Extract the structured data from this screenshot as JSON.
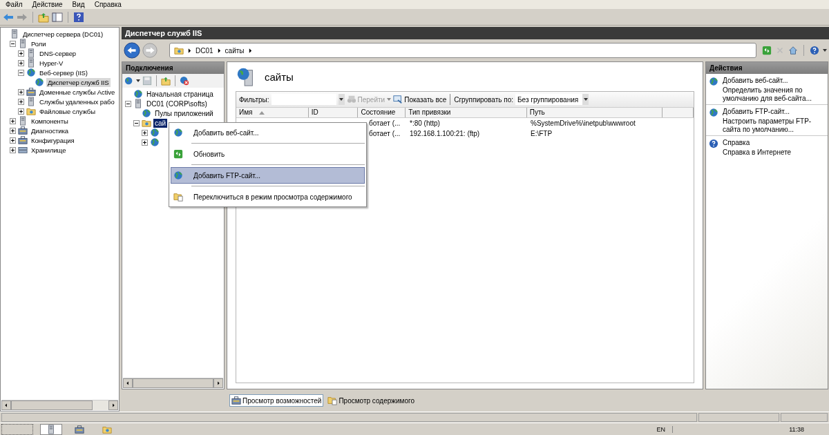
{
  "menu_bar": [
    {
      "label": "Файл"
    },
    {
      "label": "Действие"
    },
    {
      "label": "Вид"
    },
    {
      "label": "Справка"
    }
  ],
  "console_tree": [
    {
      "label": "Диспетчер сервера (DC01)",
      "kind": "server",
      "selected": false,
      "children": [
        {
          "label": "Роли",
          "kind": "server",
          "selected": false,
          "expanded": true,
          "children": [
            {
              "label": "DNS-сервер",
              "kind": "server",
              "selected": false,
              "expanded": false
            },
            {
              "label": "Hyper-V",
              "kind": "server",
              "selected": false,
              "expanded": false
            },
            {
              "label": "Веб-сервер (IIS)",
              "kind": "globe",
              "selected": false,
              "expanded": true,
              "children": [
                {
                  "label": "Диспетчер служб IIS",
                  "kind": "globe",
                  "selected": true
                }
              ]
            },
            {
              "label": "Доменные службы Active",
              "kind": "tool",
              "selected": false,
              "expanded": false
            },
            {
              "label": "Службы удаленных рабо",
              "kind": "server",
              "selected": false,
              "expanded": false
            },
            {
              "label": "Файловые службы",
              "kind": "folder",
              "selected": false,
              "expanded": false
            }
          ]
        },
        {
          "label": "Компоненты",
          "kind": "server",
          "selected": false,
          "expanded": false
        },
        {
          "label": "Диагностика",
          "kind": "tool",
          "selected": false,
          "expanded": false
        },
        {
          "label": "Конфигурация",
          "kind": "tool",
          "selected": false,
          "expanded": false
        },
        {
          "label": "Хранилище",
          "kind": "disk",
          "selected": false,
          "expanded": false
        }
      ]
    }
  ],
  "iis": {
    "title": "Диспетчер служб IIS",
    "breadcrumbs": [
      "DC01",
      "сайты"
    ],
    "connections": {
      "title": "Подключения",
      "tree": [
        {
          "label": "Начальная страница",
          "kind": "globe",
          "selected": false
        },
        {
          "label": "DC01 (CORP\\softs)",
          "kind": "server",
          "selected": false,
          "expanded": true,
          "children": [
            {
              "label": "Пулы приложений",
              "kind": "globe",
              "selected": false
            },
            {
              "label": "сай",
              "kind": "folder",
              "selected": true,
              "expanded": true,
              "children": [
                {
                  "kind": "globe",
                  "expanded": false
                },
                {
                  "kind": "globe",
                  "expanded": false
                }
              ]
            }
          ]
        }
      ]
    },
    "content": {
      "title": "сайты",
      "filter_label": "Фильтры:",
      "go_button": {
        "label": "Перейти",
        "disabled": true
      },
      "show_all": "Показать все",
      "group_label": "Сгруппировать по:",
      "group_value": "Без группирования",
      "columns": [
        {
          "label": "Имя",
          "sorted": true
        },
        {
          "label": "ID",
          "sorted": false
        },
        {
          "label": "Состояние",
          "sorted": false
        },
        {
          "label": "Тип привязки",
          "sorted": false
        },
        {
          "label": "Путь",
          "sorted": false
        }
      ],
      "rows": [
        {
          "state": "ботает (...",
          "binding": "*:80 (http)",
          "path": "%SystemDrive%\\inetpub\\wwwroot"
        },
        {
          "state": "ботает (...",
          "binding": "192.168.1.100:21: (ftp)",
          "path": "E:\\FTP"
        }
      ]
    },
    "view_tabs": [
      {
        "label": "Просмотр возможностей",
        "selected": true
      },
      {
        "label": "Просмотр содержимого",
        "selected": false
      }
    ],
    "actions": {
      "title": "Действия",
      "groups": [
        {
          "kind": "globe",
          "links": [
            "Добавить веб-сайт...",
            "Определить значения по умолчанию для веб-сайта..."
          ]
        },
        {
          "kind": "globe",
          "links": [
            "Добавить FTP-сайт...",
            "Настроить параметры FTP-сайта по умолчанию..."
          ]
        },
        {
          "kind": "help",
          "links": [
            "Справка",
            "Справка в Интернете"
          ]
        }
      ]
    }
  },
  "context_menu": [
    {
      "label": "Добавить веб-сайт...",
      "kind": "globe",
      "selected": false
    },
    {
      "label": "Обновить",
      "kind": "refresh",
      "selected": false
    },
    {
      "label": "Добавить FTP-сайт...",
      "kind": "globe",
      "selected": true
    },
    {
      "label": "Переключиться в режим просмотра содержимого",
      "kind": "doc",
      "selected": false
    }
  ],
  "taskbar": {
    "language": "EN",
    "clock": "11:38"
  }
}
